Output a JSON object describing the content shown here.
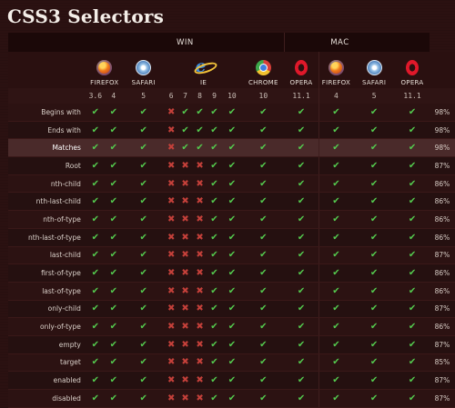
{
  "title": "CSS3 Selectors",
  "platforms": [
    "WIN",
    "MAC"
  ],
  "browsers": [
    {
      "name": "FIREFOX",
      "icon": "firefox-icon",
      "versions": [
        "3.6",
        "4"
      ]
    },
    {
      "name": "SAFARI",
      "icon": "safari-icon",
      "versions": [
        "5"
      ]
    },
    {
      "name": "IE",
      "icon": "ie-icon",
      "versions": [
        "6",
        "7",
        "8",
        "9",
        "10"
      ]
    },
    {
      "name": "CHROME",
      "icon": "chrome-icon",
      "versions": [
        "10"
      ]
    },
    {
      "name": "OPERA",
      "icon": "opera-icon",
      "versions": [
        "11.1"
      ]
    },
    {
      "name": "FIREFOX",
      "icon": "firefox-icon",
      "versions": [
        "4"
      ]
    },
    {
      "name": "SAFARI",
      "icon": "safari-icon",
      "versions": [
        "5"
      ]
    },
    {
      "name": "OPERA",
      "icon": "opera-icon",
      "versions": [
        "11.1"
      ]
    }
  ],
  "symbols": {
    "yes": "✔",
    "no": "✖"
  },
  "colors": {
    "yes": "#54c94e",
    "no": "#c4403a",
    "highlight_row": "#4a2a2a"
  },
  "rows": [
    {
      "feature": "Begins with",
      "support": [
        1,
        1,
        1,
        0,
        1,
        1,
        1,
        1,
        1,
        1,
        1,
        1,
        1
      ],
      "pct": "98%"
    },
    {
      "feature": "Ends with",
      "support": [
        1,
        1,
        1,
        0,
        1,
        1,
        1,
        1,
        1,
        1,
        1,
        1,
        1
      ],
      "pct": "98%"
    },
    {
      "feature": "Matches",
      "support": [
        1,
        1,
        1,
        0,
        1,
        1,
        1,
        1,
        1,
        1,
        1,
        1,
        1
      ],
      "pct": "98%",
      "highlight": true
    },
    {
      "feature": "Root",
      "support": [
        1,
        1,
        1,
        0,
        0,
        0,
        1,
        1,
        1,
        1,
        1,
        1,
        1
      ],
      "pct": "87%"
    },
    {
      "feature": "nth-child",
      "support": [
        1,
        1,
        1,
        0,
        0,
        0,
        1,
        1,
        1,
        1,
        1,
        1,
        1
      ],
      "pct": "86%"
    },
    {
      "feature": "nth-last-child",
      "support": [
        1,
        1,
        1,
        0,
        0,
        0,
        1,
        1,
        1,
        1,
        1,
        1,
        1
      ],
      "pct": "86%"
    },
    {
      "feature": "nth-of-type",
      "support": [
        1,
        1,
        1,
        0,
        0,
        0,
        1,
        1,
        1,
        1,
        1,
        1,
        1
      ],
      "pct": "86%"
    },
    {
      "feature": "nth-last-of-type",
      "support": [
        1,
        1,
        1,
        0,
        0,
        0,
        1,
        1,
        1,
        1,
        1,
        1,
        1
      ],
      "pct": "86%"
    },
    {
      "feature": "last-child",
      "support": [
        1,
        1,
        1,
        0,
        0,
        0,
        1,
        1,
        1,
        1,
        1,
        1,
        1
      ],
      "pct": "87%"
    },
    {
      "feature": "first-of-type",
      "support": [
        1,
        1,
        1,
        0,
        0,
        0,
        1,
        1,
        1,
        1,
        1,
        1,
        1
      ],
      "pct": "86%"
    },
    {
      "feature": "last-of-type",
      "support": [
        1,
        1,
        1,
        0,
        0,
        0,
        1,
        1,
        1,
        1,
        1,
        1,
        1
      ],
      "pct": "86%"
    },
    {
      "feature": "only-child",
      "support": [
        1,
        1,
        1,
        0,
        0,
        0,
        1,
        1,
        1,
        1,
        1,
        1,
        1
      ],
      "pct": "87%"
    },
    {
      "feature": "only-of-type",
      "support": [
        1,
        1,
        1,
        0,
        0,
        0,
        1,
        1,
        1,
        1,
        1,
        1,
        1
      ],
      "pct": "86%"
    },
    {
      "feature": "empty",
      "support": [
        1,
        1,
        1,
        0,
        0,
        0,
        1,
        1,
        1,
        1,
        1,
        1,
        1
      ],
      "pct": "87%"
    },
    {
      "feature": "target",
      "support": [
        1,
        1,
        1,
        0,
        0,
        0,
        1,
        1,
        1,
        1,
        1,
        1,
        1
      ],
      "pct": "85%"
    },
    {
      "feature": "enabled",
      "support": [
        1,
        1,
        1,
        0,
        0,
        0,
        1,
        1,
        1,
        1,
        1,
        1,
        1
      ],
      "pct": "87%"
    },
    {
      "feature": "disabled",
      "support": [
        1,
        1,
        1,
        0,
        0,
        0,
        1,
        1,
        1,
        1,
        1,
        1,
        1
      ],
      "pct": "87%"
    }
  ]
}
